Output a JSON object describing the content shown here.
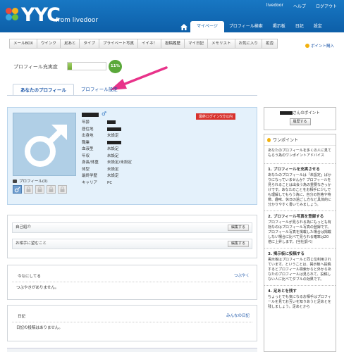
{
  "header": {
    "logo_text": "YYC",
    "logo_from": "from livedoor",
    "top_links": [
      "livedoor",
      "ヘルプ",
      "ログアウト"
    ],
    "nav": [
      "マイページ",
      "プロフィール検索",
      "掲示板",
      "日記",
      "設定"
    ],
    "nav_selected": "マイページ",
    "brand_color": "#0d5fa8"
  },
  "subnav": [
    "メールBOX",
    "ウインク",
    "足あと",
    "タイプ",
    "プライベート写真",
    "イイネ！",
    "投稿履歴",
    "マイ日記",
    "メモリスト",
    "お気に入り",
    "拒否"
  ],
  "point_link": "ポイント購入",
  "profile_fill": {
    "label": "プロフィール充実度",
    "value": "11%",
    "fraction": 0.11
  },
  "tabs": [
    {
      "label": "あなたのプロフィール",
      "active": true
    },
    {
      "label": "プロフィール設定",
      "active": false
    }
  ],
  "profile": {
    "last_login_badge": "最終ログイン5分以内",
    "photo_label": "プロフィール(0)",
    "fields": [
      {
        "key": "年齢",
        "value": ""
      },
      {
        "key": "居住地",
        "value": ""
      },
      {
        "key": "出身地",
        "value": "未設定"
      },
      {
        "key": "職業",
        "value": ""
      },
      {
        "key": "血液型",
        "value": "未設定"
      },
      {
        "key": "年収",
        "value": "未設定"
      },
      {
        "key": "身長/体重",
        "value": "未設定/未設定"
      },
      {
        "key": "体型",
        "value": "未設定"
      },
      {
        "key": "最終学歴",
        "value": "未設定"
      },
      {
        "key": "キャリア",
        "value": "PC"
      }
    ]
  },
  "edit_rows": [
    {
      "label": "自己紹介",
      "button": "編集する"
    },
    {
      "label": "お相手に望むこと",
      "button": "編集する"
    }
  ],
  "tweet": {
    "title": "今なにしてる",
    "link": "つぶやく",
    "empty": "つぶやきがありません。"
  },
  "diary": {
    "title": "日記",
    "link": "みんなの日記",
    "empty": "日記の投稿はありません。"
  },
  "points_box": {
    "suffix": "さんのポイント",
    "button": "履歴する"
  },
  "one_point": {
    "title": "ワンポイント",
    "intro": "あなたのプロフィールを多くの人に見てもらう為のワンポイントアドバイス",
    "sections": [
      {
        "heading": "1. プロフィールを充実させる",
        "text": "あなたのプロフィールは「未設定」ばかりになっていませんか？プロフィールを見られることは出会う為の重要なきっかけです。あなたのことをお相手に少しでも理解してもらう為に、自分の性格や特徴、趣味、休日の過ごし方など具体的に分かりやすく書いてみましょう。"
      },
      {
        "heading": "2. プロフィール写真を登録する",
        "text": "プロフィールが見られる為にもっとも有効なのはプロフィール写真の登録です。プロフィール写真を掲載した場合は掲載しない場合に比べて見られる確率は20倍に上昇します。(当社調べ)"
      },
      {
        "heading": "3. 掲示板に投稿する",
        "text": "掲示板はプロフィールと同じ位利用されています。ということは、掲示板へ投稿するとプロフィール検索からと外からあなたのプロフィールは見られて、投稿しない人に比べてダブルの効果です。"
      },
      {
        "heading": "4. 足あとを残す",
        "text": "ちょっとでも気になるお相手はプロフィールを見てお互いを知りあうと足あとを残しましょう。足あとから"
      }
    ]
  }
}
